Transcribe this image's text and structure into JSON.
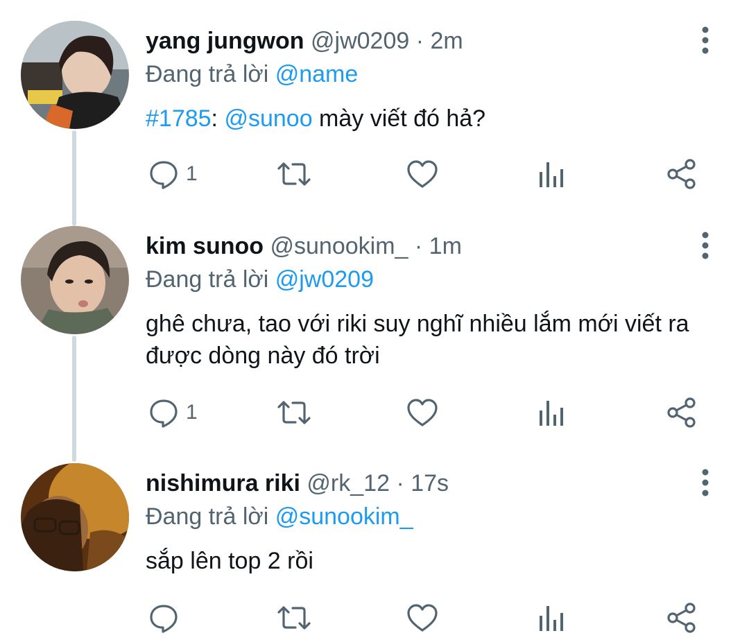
{
  "tweets": [
    {
      "display_name": "yang jungwon",
      "handle": "@jw0209",
      "separator": "·",
      "time": "2m",
      "reply_prefix": "Đang trả lời",
      "reply_to": "@name",
      "body_hashtag": "#1785",
      "body_colon": ":",
      "body_mention": "@sunoo",
      "body_rest": " mày viết đó hả?",
      "reply_count": "1"
    },
    {
      "display_name": "kim sunoo",
      "handle": "@sunookim_",
      "separator": "·",
      "time": "1m",
      "reply_prefix": "Đang trả lời",
      "reply_to": "@jw0209",
      "body": "ghê chưa, tao với riki suy nghĩ nhiều lắm mới viết ra được dòng này đó trời",
      "reply_count": "1"
    },
    {
      "display_name": "nishimura riki",
      "handle": "@rk_12",
      "separator": "·",
      "time": "17s",
      "reply_prefix": "Đang trả lời",
      "reply_to": "@sunookim_",
      "body": "sắp lên top 2 rồi",
      "reply_count": ""
    }
  ],
  "icons": {
    "reply": "speech-bubble-icon",
    "retweet": "retweet-icon",
    "like": "heart-icon",
    "views": "bar-chart-icon",
    "share": "share-icon",
    "more": "vertical-ellipsis-icon"
  },
  "colors": {
    "link": "#1d9bf0",
    "secondary_text": "#536471",
    "primary_text": "#0f1419",
    "thread_line": "#cfd9de"
  }
}
